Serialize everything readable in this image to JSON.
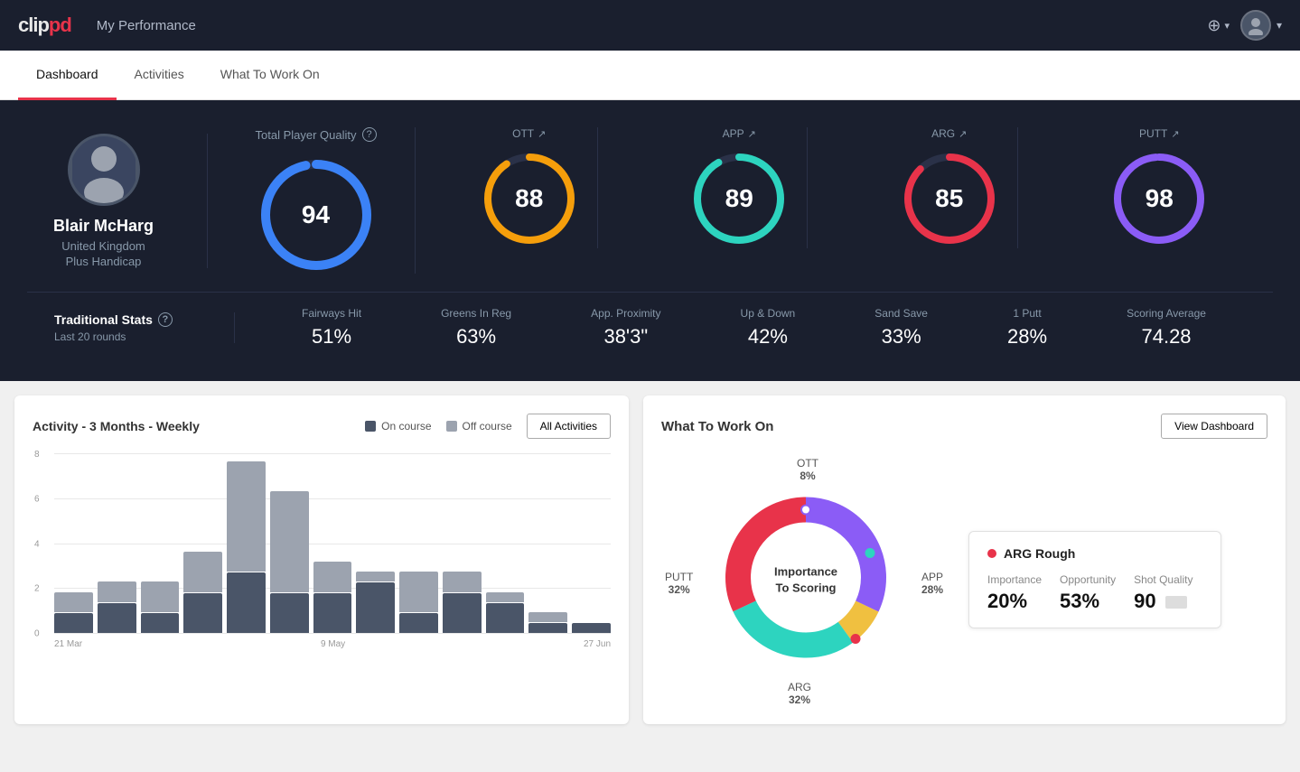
{
  "header": {
    "logo_clip": "clip",
    "logo_pd": "pd",
    "title": "My Performance",
    "add_icon": "⊕",
    "avatar_icon": "👤"
  },
  "nav": {
    "tabs": [
      {
        "label": "Dashboard",
        "active": true
      },
      {
        "label": "Activities",
        "active": false
      },
      {
        "label": "What To Work On",
        "active": false
      }
    ]
  },
  "player": {
    "name": "Blair McHarg",
    "country": "United Kingdom",
    "handicap": "Plus Handicap"
  },
  "scores": {
    "total_quality_label": "Total Player Quality",
    "total_value": "94",
    "ott_label": "OTT",
    "ott_value": "88",
    "app_label": "APP",
    "app_value": "89",
    "arg_label": "ARG",
    "arg_value": "85",
    "putt_label": "PUTT",
    "putt_value": "98"
  },
  "trad_stats": {
    "title": "Traditional Stats",
    "subtitle": "Last 20 rounds",
    "stats": [
      {
        "label": "Fairways Hit",
        "value": "51%"
      },
      {
        "label": "Greens In Reg",
        "value": "63%"
      },
      {
        "label": "App. Proximity",
        "value": "38'3\""
      },
      {
        "label": "Up & Down",
        "value": "42%"
      },
      {
        "label": "Sand Save",
        "value": "33%"
      },
      {
        "label": "1 Putt",
        "value": "28%"
      },
      {
        "label": "Scoring Average",
        "value": "74.28"
      }
    ]
  },
  "activity_chart": {
    "title": "Activity - 3 Months - Weekly",
    "legend_on": "On course",
    "legend_off": "Off course",
    "btn_label": "All Activities",
    "y_labels": [
      "8",
      "6",
      "4",
      "2",
      "0"
    ],
    "x_labels": [
      "21 Mar",
      "",
      "",
      "",
      "9 May",
      "",
      "",
      "",
      "27 Jun"
    ],
    "bars": [
      {
        "on": 1,
        "off": 1
      },
      {
        "on": 1.5,
        "off": 1
      },
      {
        "on": 1,
        "off": 1.5
      },
      {
        "on": 2,
        "off": 2
      },
      {
        "on": 3,
        "off": 5.5
      },
      {
        "on": 2,
        "off": 5
      },
      {
        "on": 2,
        "off": 1.5
      },
      {
        "on": 2.5,
        "off": 0.5
      },
      {
        "on": 1,
        "off": 2
      },
      {
        "on": 2,
        "off": 1
      },
      {
        "on": 1.5,
        "off": 0.5
      },
      {
        "on": 0.5,
        "off": 0.5
      },
      {
        "on": 0.5,
        "off": 0
      }
    ]
  },
  "what_to_work_on": {
    "title": "What To Work On",
    "btn_label": "View Dashboard",
    "donut_center": [
      "Importance",
      "To Scoring"
    ],
    "segments": [
      {
        "label": "OTT",
        "pct": "8%",
        "color": "#f0c040"
      },
      {
        "label": "APP",
        "pct": "28%",
        "color": "#2dd4bf"
      },
      {
        "label": "ARG",
        "pct": "32%",
        "color": "#e8334a"
      },
      {
        "label": "PUTT",
        "pct": "32%",
        "color": "#8b5cf6"
      }
    ],
    "card": {
      "title": "ARG Rough",
      "importance_label": "Importance",
      "importance_value": "20%",
      "opportunity_label": "Opportunity",
      "opportunity_value": "53%",
      "shot_quality_label": "Shot Quality",
      "shot_quality_value": "90"
    }
  }
}
